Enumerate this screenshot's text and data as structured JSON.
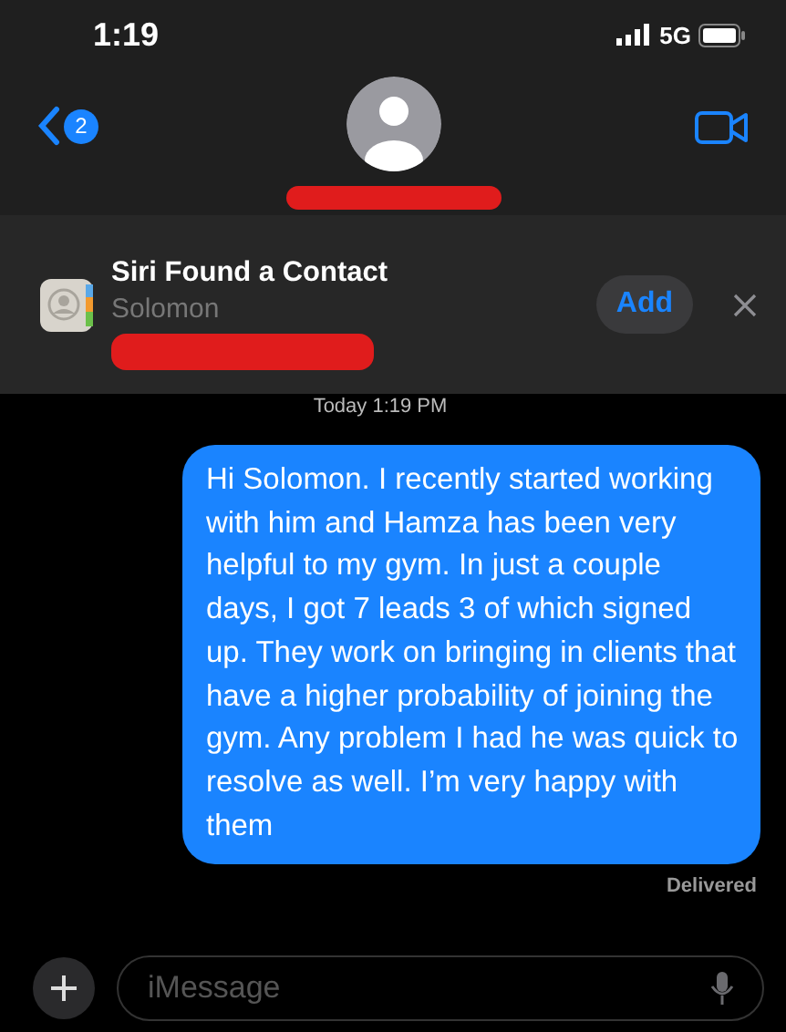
{
  "status_bar": {
    "time": "1:19",
    "network": "5G"
  },
  "header": {
    "unread_badge": "2"
  },
  "siri_banner": {
    "title": "Siri Found a Contact",
    "name": "Solomon",
    "add_button": "Add"
  },
  "timestamp": "Today 1:19 PM",
  "messages": [
    {
      "kind": "sent",
      "text": "Hi Solomon. I recently started working with him and Hamza has been very helpful to my gym. In just a couple days, I got 7 leads 3 of which signed up. They work on bringing in clients that have a higher probability of joining the gym. Any problem I had he was quick to resolve as well. I’m very happy with them"
    }
  ],
  "delivery_status": "Delivered",
  "composer": {
    "placeholder": "iMessage"
  }
}
